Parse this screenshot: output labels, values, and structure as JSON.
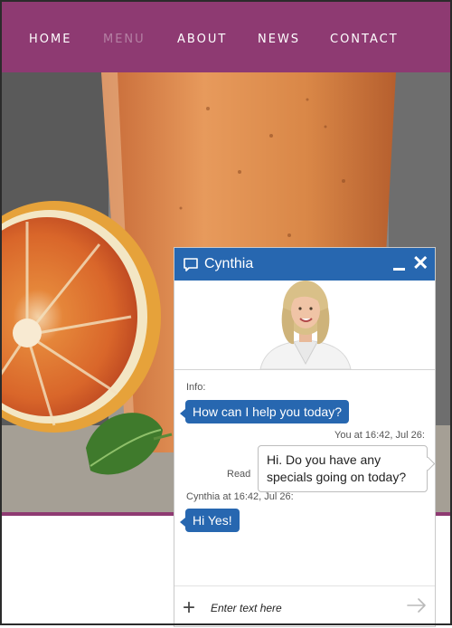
{
  "nav": {
    "items": [
      {
        "label": "HOME",
        "active": false
      },
      {
        "label": "MENU",
        "active": true
      },
      {
        "label": "ABOUT",
        "active": false
      },
      {
        "label": "NEWS",
        "active": false
      },
      {
        "label": "CONTACT",
        "active": false
      }
    ]
  },
  "chat": {
    "agent_name": "Cynthia",
    "info_label": "Info:",
    "messages": [
      {
        "from": "agent",
        "text": "How can I help you today?"
      },
      {
        "from": "user",
        "meta": "You at 16:42, Jul 26:",
        "text_line1": "Hi. Do you have any",
        "text_line2": "specials going on today?",
        "status": "Read"
      },
      {
        "from": "agent",
        "meta": "Cynthia at 16:42, Jul 26:",
        "text": "Hi Yes!"
      }
    ],
    "input_placeholder": "Enter text here"
  },
  "colors": {
    "brand": "#8e3a72",
    "chat_blue": "#2767b0"
  },
  "icons": [
    "chat-bubble-icon",
    "minimize-icon",
    "close-icon",
    "plus-icon",
    "send-arrow-icon"
  ]
}
